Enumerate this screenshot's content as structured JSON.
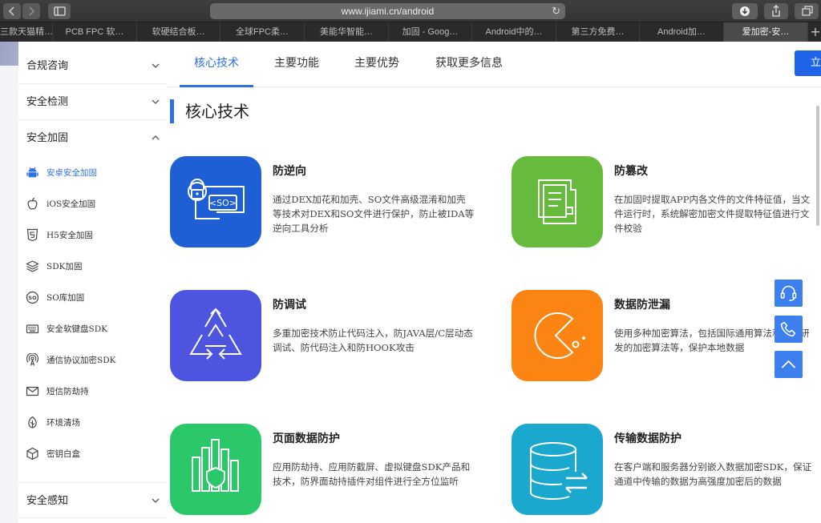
{
  "browser": {
    "url": "www.ijiami.cn/android",
    "tabs": [
      {
        "label": "三款天猫精…",
        "active": false
      },
      {
        "label": "PCB FPC 软…",
        "active": false
      },
      {
        "label": "软硬结合板…",
        "active": false
      },
      {
        "label": "全球FPC柔…",
        "active": false
      },
      {
        "label": "美能华智能…",
        "active": false
      },
      {
        "label": "加固 - Goog…",
        "active": false
      },
      {
        "label": "Android中的…",
        "active": false
      },
      {
        "label": "第三方免费…",
        "active": false
      },
      {
        "label": "Android加…",
        "active": false
      },
      {
        "label": "爱加密-安…",
        "active": true
      }
    ]
  },
  "sidebar": {
    "categories": [
      {
        "label": "合规咨询",
        "expanded": false
      },
      {
        "label": "安全检测",
        "expanded": false
      },
      {
        "label": "安全加固",
        "expanded": true
      },
      {
        "label": "安全感知",
        "expanded": false
      }
    ],
    "items": [
      {
        "label": "安卓安全加固",
        "icon": "android-icon",
        "active": true
      },
      {
        "label": "iOS安全加固",
        "icon": "apple-icon",
        "active": false
      },
      {
        "label": "H5安全加固",
        "icon": "html5-icon",
        "active": false
      },
      {
        "label": "SDK加固",
        "icon": "layers-icon",
        "active": false
      },
      {
        "label": "SO库加固",
        "icon": "so-icon",
        "active": false
      },
      {
        "label": "安全软键盘SDK",
        "icon": "keyboard-icon",
        "active": false
      },
      {
        "label": "通信协议加密SDK",
        "icon": "antenna-icon",
        "active": false
      },
      {
        "label": "短信防劫持",
        "icon": "mail-icon",
        "active": false
      },
      {
        "label": "环境清场",
        "icon": "leaf-icon",
        "active": false
      },
      {
        "label": "密钥白盒",
        "icon": "cube-icon",
        "active": false
      }
    ]
  },
  "main": {
    "tabs": [
      {
        "label": "核心技术",
        "active": true
      },
      {
        "label": "主要功能",
        "active": false
      },
      {
        "label": "主要优势",
        "active": false
      },
      {
        "label": "获取更多信息",
        "active": false
      }
    ],
    "cta_label": "立",
    "section_title": "核心技术",
    "features": [
      {
        "title": "防逆向",
        "desc": "通过DEX加花和加壳、SO文件高级混淆和加壳等技术对DEX和SO文件进行保护，防止被IDA等逆向工具分析",
        "icon": "lock-so-icon",
        "icon_text": "<SO>",
        "color": "#1f5fd6"
      },
      {
        "title": "防篡改",
        "desc": "在加固时提取APP内各文件的文件特征值，当文件运行时，系统解密加密文件提取特征值进行文件校验",
        "icon": "document-icon",
        "color": "#67bb3c"
      },
      {
        "title": "防调试",
        "desc": "多重加密技术防止代码注入，防JAVA层/C层动态调试、防代码注入和防HOOK攻击",
        "icon": "recycle-triangle-icon",
        "color": "#4d55e0"
      },
      {
        "title": "数据防泄漏",
        "desc": "使用多种加密算法，包括国际通用算法和自主研发的加密算法等，保护本地数据",
        "icon": "pacman-icon",
        "color": "#fb8412"
      },
      {
        "title": "页面数据防护",
        "desc": "应用防劫持、应用防截屏、虚拟键盘SDK产品和技术，防界面劫持插件对组件进行全方位监听",
        "icon": "shield-bars-icon",
        "color": "#2bc86a"
      },
      {
        "title": "传输数据防护",
        "desc": "在客户端和服务器分别嵌入数据加密SDK，保证通道中传输的数据为高强度加密后的数据",
        "icon": "database-transfer-icon",
        "color": "#1aa8cf"
      }
    ]
  },
  "float_buttons": [
    {
      "icon": "headset-icon"
    },
    {
      "icon": "phone-icon"
    },
    {
      "icon": "back-to-top-icon"
    }
  ]
}
